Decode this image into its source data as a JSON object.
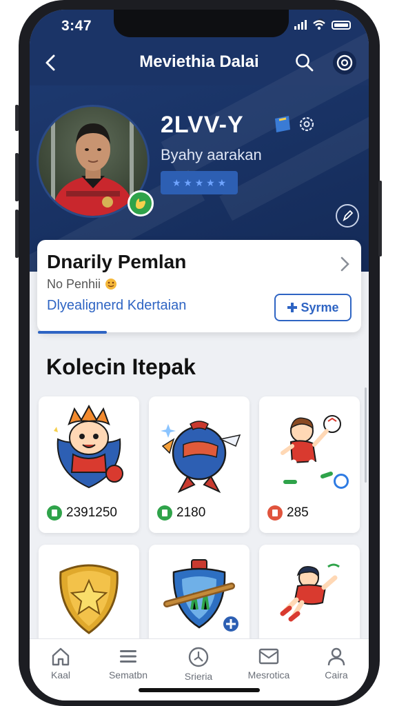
{
  "status_bar": {
    "time": "3:47"
  },
  "header": {
    "title": "Meviethia Dalai",
    "back_icon": "chevron-left-icon",
    "search_icon": "search-icon",
    "settings_icon": "settings-icon"
  },
  "profile": {
    "username": "2LVV-Y",
    "subtitle": "Byahy aarakan",
    "rank_stars": "★ ★ ★ ★ ★",
    "avatar_icon": "player-photo",
    "edit_icon": "edit-icon"
  },
  "info_card": {
    "title": "Dnarily Pemlan",
    "subtitle": "No Penhii",
    "link": "Dlyealignerd Kdertaian",
    "sync_label": "Syrme",
    "sync_icon": "plus-icon"
  },
  "collection": {
    "title": "Kolecin Itepak",
    "items": [
      {
        "name": "mascot-sticker",
        "count": "2391250",
        "count_color": "#2fa34a"
      },
      {
        "name": "ball-sticker",
        "count": "2180",
        "count_color": "#2fa34a"
      },
      {
        "name": "player-sticker",
        "count": "285",
        "count_color": "#e0543d"
      },
      {
        "name": "shield-sticker"
      },
      {
        "name": "crest-sticker"
      },
      {
        "name": "diving-player-sticker"
      }
    ]
  },
  "tabbar": {
    "tabs": [
      {
        "label": "Kaal",
        "icon": "home-icon"
      },
      {
        "label": "Sematbn",
        "icon": "menu-icon"
      },
      {
        "label": "Srieria",
        "icon": "ball-icon"
      },
      {
        "label": "Mesrotica",
        "icon": "mail-icon"
      },
      {
        "label": "Caira",
        "icon": "profile-icon"
      }
    ]
  },
  "colors": {
    "header_bg": "#1b3467",
    "accent": "#2e64c3",
    "page_bg": "#eef0f4"
  }
}
